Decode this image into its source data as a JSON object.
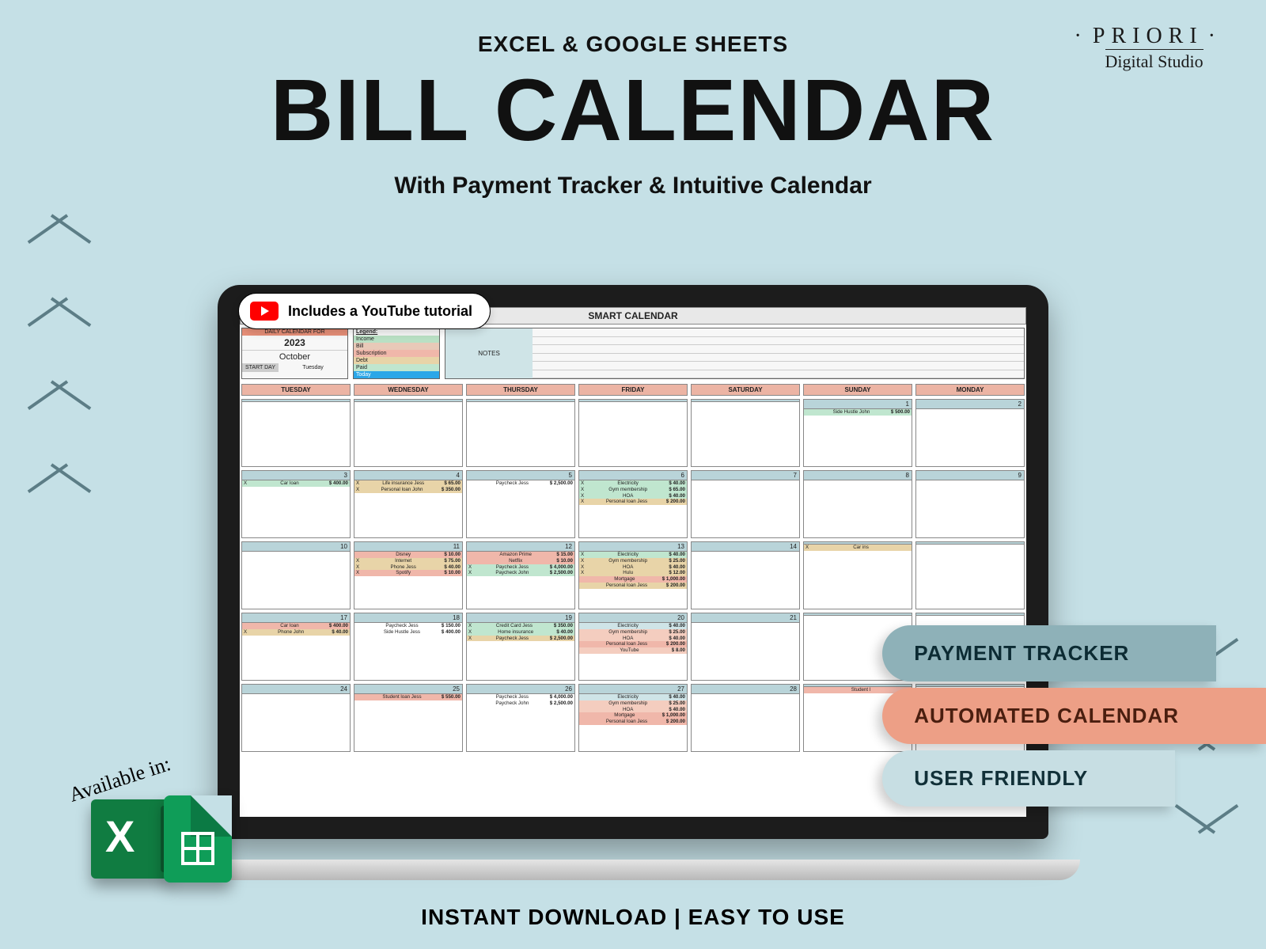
{
  "brand": {
    "name": "PRIORI",
    "sub": "Digital Studio"
  },
  "header": {
    "supertitle": "EXCEL & GOOGLE SHEETS",
    "title": "BILL CALENDAR",
    "subtitle": "With Payment Tracker & Intuitive Calendar"
  },
  "tutorial_badge": "Includes a YouTube tutorial",
  "sheet": {
    "title": "SMART CALENDAR",
    "date_header": "DAILY CALENDAR FOR",
    "year": "2023",
    "month": "October",
    "start_day_label": "START DAY",
    "start_day": "Tuesday",
    "legend_title": "Legend:",
    "legend": [
      "Income",
      "Bill",
      "Subscription",
      "Debt",
      "Paid",
      "Today"
    ],
    "notes_label": "NOTES",
    "day_headers": [
      "TUESDAY",
      "WEDNESDAY",
      "THURSDAY",
      "FRIDAY",
      "SATURDAY",
      "SUNDAY",
      "MONDAY"
    ],
    "weeks": [
      [
        {
          "n": "",
          "items": []
        },
        {
          "n": "",
          "items": []
        },
        {
          "n": "",
          "items": []
        },
        {
          "n": "",
          "items": []
        },
        {
          "n": "",
          "items": []
        },
        {
          "n": "1",
          "items": [
            {
              "c": "e-green",
              "t": "Side Hustle John",
              "a": "$ 500.00"
            }
          ]
        },
        {
          "n": "2",
          "items": []
        }
      ],
      [
        {
          "n": "3",
          "items": [
            {
              "c": "e-green",
              "x": "X",
              "t": "Car loan",
              "a": "$ 400.00"
            }
          ]
        },
        {
          "n": "4",
          "items": [
            {
              "c": "e-tan",
              "x": "X",
              "t": "Life insurance Jess",
              "a": "$ 65.00"
            },
            {
              "c": "e-tan",
              "x": "X",
              "t": "Personal loan John",
              "a": "$ 350.00"
            }
          ]
        },
        {
          "n": "5",
          "items": [
            {
              "c": "",
              "t": "Paycheck Jess",
              "a": "$ 2,500.00"
            }
          ]
        },
        {
          "n": "6",
          "items": [
            {
              "c": "e-green",
              "x": "X",
              "t": "Electricity",
              "a": "$ 40.00"
            },
            {
              "c": "e-green",
              "x": "X",
              "t": "Gym membership",
              "a": "$ 65.00"
            },
            {
              "c": "e-green",
              "x": "X",
              "t": "HOA",
              "a": "$ 40.00"
            },
            {
              "c": "e-tan",
              "x": "X",
              "t": "Personal loan Jess",
              "a": "$ 200.00"
            }
          ]
        },
        {
          "n": "7",
          "items": []
        },
        {
          "n": "8",
          "items": []
        },
        {
          "n": "9",
          "items": []
        }
      ],
      [
        {
          "n": "10",
          "items": []
        },
        {
          "n": "11",
          "items": [
            {
              "c": "e-salmon",
              "t": "Disney",
              "a": "$ 10.00"
            },
            {
              "c": "e-tan",
              "x": "X",
              "t": "Internet",
              "a": "$ 75.00"
            },
            {
              "c": "e-tan",
              "x": "X",
              "t": "Phone Jess",
              "a": "$ 40.00"
            },
            {
              "c": "e-salmon",
              "x": "X",
              "t": "Spotify",
              "a": "$ 10.00"
            }
          ]
        },
        {
          "n": "12",
          "items": [
            {
              "c": "e-salmon",
              "t": "Amazon Prime",
              "a": "$ 15.00"
            },
            {
              "c": "e-salmon",
              "t": "Netflix",
              "a": "$ 10.00"
            },
            {
              "c": "e-green",
              "x": "X",
              "t": "Paycheck Jess",
              "a": "$ 4,000.00"
            },
            {
              "c": "e-green",
              "x": "X",
              "t": "Paycheck John",
              "a": "$ 2,500.00"
            }
          ]
        },
        {
          "n": "13",
          "items": [
            {
              "c": "e-green",
              "x": "X",
              "t": "Electricity",
              "a": "$ 40.00"
            },
            {
              "c": "e-tan",
              "x": "X",
              "t": "Gym membership",
              "a": "$ 25.00"
            },
            {
              "c": "e-tan",
              "x": "X",
              "t": "HOA",
              "a": "$ 40.00"
            },
            {
              "c": "e-tan",
              "x": "X",
              "t": "Hulu",
              "a": "$ 12.00"
            },
            {
              "c": "e-salmon",
              "t": "Mortgage",
              "a": "$ 1,000.00"
            },
            {
              "c": "e-tan",
              "t": "Personal loan Jess",
              "a": "$ 200.00"
            }
          ]
        },
        {
          "n": "14",
          "items": []
        },
        {
          "n": "",
          "items": [
            {
              "c": "e-tan",
              "x": "X",
              "t": "Car ins",
              "a": ""
            }
          ]
        },
        {
          "n": "",
          "items": []
        }
      ],
      [
        {
          "n": "17",
          "items": [
            {
              "c": "e-salmon",
              "t": "Car loan",
              "a": "$ 400.00"
            },
            {
              "c": "e-tan",
              "x": "X",
              "t": "Phone John",
              "a": "$ 40.00"
            }
          ]
        },
        {
          "n": "18",
          "items": [
            {
              "c": "",
              "t": "Paycheck Jess",
              "a": "$ 150.00"
            },
            {
              "c": "",
              "t": "Side Hustle Jess",
              "a": "$ 400.00"
            }
          ]
        },
        {
          "n": "19",
          "items": [
            {
              "c": "e-green",
              "x": "X",
              "t": "Credit Card Jess",
              "a": "$ 350.00"
            },
            {
              "c": "e-green",
              "x": "X",
              "t": "Home insurance",
              "a": "$ 40.00"
            },
            {
              "c": "e-tan",
              "x": "X",
              "t": "Paycheck Jess",
              "a": "$ 2,500.00"
            }
          ]
        },
        {
          "n": "20",
          "items": [
            {
              "c": "e-blue",
              "t": "Electricity",
              "a": "$ 40.00"
            },
            {
              "c": "e-peach",
              "t": "Gym membership",
              "a": "$ 25.00"
            },
            {
              "c": "e-peach",
              "t": "HOA",
              "a": "$ 40.00"
            },
            {
              "c": "e-salmon",
              "t": "Personal loan Jess",
              "a": "$ 200.00"
            },
            {
              "c": "e-peach",
              "t": "YouTube",
              "a": "$ 8.00"
            }
          ]
        },
        {
          "n": "21",
          "items": []
        },
        {
          "n": "",
          "items": []
        },
        {
          "n": "",
          "items": []
        }
      ],
      [
        {
          "n": "24",
          "items": []
        },
        {
          "n": "25",
          "items": [
            {
              "c": "e-salmon",
              "t": "Student loan Jess",
              "a": "$ 550.00"
            }
          ]
        },
        {
          "n": "26",
          "items": [
            {
              "c": "",
              "t": "Paycheck Jess",
              "a": "$ 4,000.00"
            },
            {
              "c": "",
              "t": "Paycheck John",
              "a": "$ 2,500.00"
            }
          ]
        },
        {
          "n": "27",
          "items": [
            {
              "c": "e-blue",
              "t": "Electricity",
              "a": "$ 40.00"
            },
            {
              "c": "e-peach",
              "t": "Gym membership",
              "a": "$ 25.00"
            },
            {
              "c": "e-peach",
              "t": "HOA",
              "a": "$ 40.00"
            },
            {
              "c": "e-salmon",
              "t": "Mortgage",
              "a": "$ 1,000.00"
            },
            {
              "c": "e-salmon",
              "t": "Personal loan Jess",
              "a": "$ 200.00"
            }
          ]
        },
        {
          "n": "28",
          "items": []
        },
        {
          "n": "",
          "items": [
            {
              "c": "e-salmon",
              "t": "Student l",
              "a": ""
            }
          ]
        },
        {
          "n": "",
          "items": []
        }
      ]
    ]
  },
  "pills": [
    "PAYMENT TRACKER",
    "AUTOMATED CALENDAR",
    "USER FRIENDLY"
  ],
  "available_label": "Available in:",
  "footer": "INSTANT DOWNLOAD  |  EASY TO USE"
}
